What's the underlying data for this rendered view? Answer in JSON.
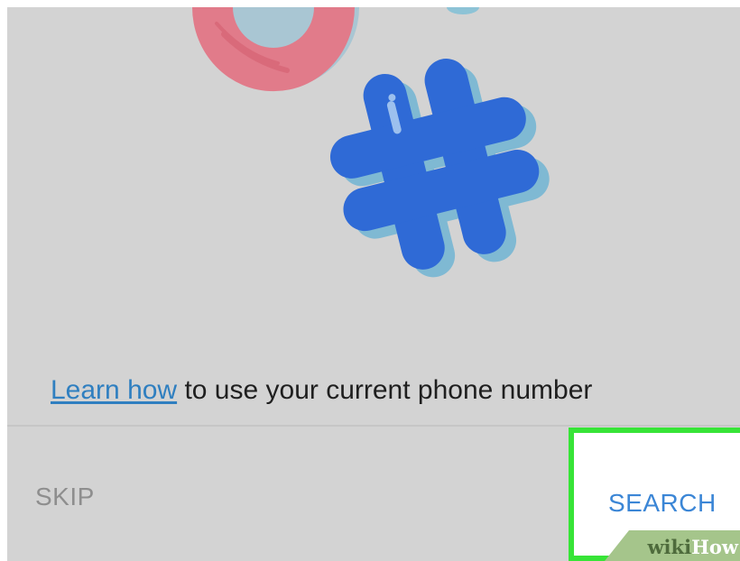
{
  "illustration": {
    "icons": [
      "pink-ring-icon",
      "blue-hashtag-icon"
    ],
    "colors": {
      "ring": "#e17b8a",
      "hashtag": "#2f6ad6",
      "hashtag_shadow": "#7fb9d3"
    }
  },
  "info": {
    "link_text": "Learn how",
    "rest_text": " to use your current phone number",
    "link_color": "#2f7fc0"
  },
  "actions": {
    "skip_label": "SKIP",
    "search_label": "SEARCH",
    "accent_color": "#3b86d6",
    "highlight_color": "#37e437"
  },
  "watermark": {
    "part1": "wiki",
    "part2": "How"
  }
}
